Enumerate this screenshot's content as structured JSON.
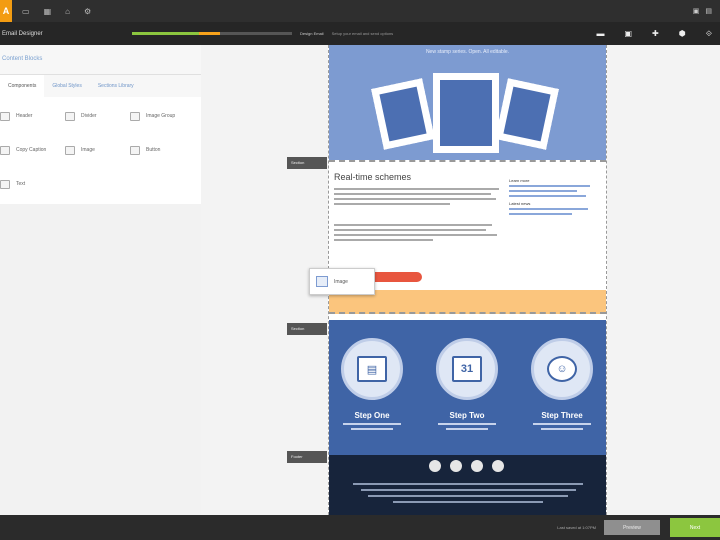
{
  "app": {
    "logo_letter": "A",
    "top_nav": [
      "▭",
      "▦",
      "⌂",
      "⚙"
    ],
    "top_right": [
      "▣",
      "▤"
    ]
  },
  "toolbar": {
    "title": "Email Designer",
    "progress_fraction": 0.55,
    "step_active": "Design Email",
    "step_next": "Setup your email and send options",
    "icons": [
      "▬",
      "▣",
      "✚",
      "⬢",
      "⟐"
    ]
  },
  "left_panel": {
    "header": "Content Blocks",
    "tabs": [
      "Components",
      "Global Styles",
      "Sections Library"
    ],
    "blocks": [
      "Header",
      "Divider",
      "Image Group",
      "Copy Caption",
      "Image",
      "Button",
      "Text"
    ]
  },
  "email": {
    "hero_text": "New stamp series. Open. All editable.",
    "section_title": "Real-time schemes",
    "sidebar_headings": [
      "Learn more",
      "Latest news"
    ],
    "drag_label": "Image",
    "steps": [
      {
        "title": "Step One",
        "icon": "▤"
      },
      {
        "title": "Step Two",
        "icon": "31"
      },
      {
        "title": "Step Three",
        "icon": "☺"
      }
    ]
  },
  "section_tags": [
    "Section",
    "Section",
    "Footer"
  ],
  "bottom": {
    "status": "Last saved at 1:07PM",
    "secondary_button": "Preview",
    "primary_button": "Next"
  },
  "colors": {
    "accent_orange": "#f39c12",
    "progress_green": "#8cc63f",
    "hero_blue": "#7d9bd1",
    "steps_blue": "#3f64a6",
    "cta_red": "#e8563f",
    "footer_navy": "#17243b"
  }
}
